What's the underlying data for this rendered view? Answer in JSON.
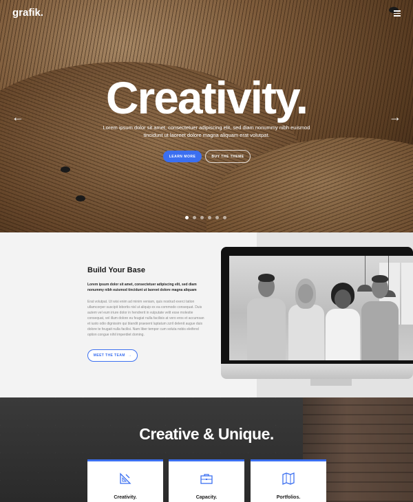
{
  "header": {
    "logo": "grafik.",
    "menu_icon": "hamburger-menu-icon"
  },
  "hero": {
    "title": "Creativity.",
    "subtitle": "Lorem ipsum dolor sit amet, consectetuer adipiscing elit, sed diam nonummy nibh euismod tincidunt ut laoreet dolore magna aliquam erat volutpat.",
    "prev_arrow": "←",
    "next_arrow": "→",
    "primary_button": "LEARN MORE",
    "secondary_button": "BUY THE THEME",
    "slides": 6,
    "active_slide": 1,
    "accent_color": "#3b6ff0"
  },
  "about": {
    "title": "Build Your Base",
    "lead": "Lorem ipsum dolor sit amet, consectetuer adipiscing elit, sed diam nonummy nibh euismod tincidunt ut laoreet dolore magna aliquam",
    "body": "Erat volutpat. Ut wisi enim ad minim veniam, quis nostrud exerci tation ullamcorper suscipit lobortis nisl ut aliquip ex ea commodo consequat. Duis autem vel eum iriure dolor in hendrerit in vulputate velit esse molestie consequat, vel illum dolore eu feugiat nulla facilisis at vero eros et accumsan et iusto odio dignissim qui blandit praesent luptatum zzril delenit augue duis dolore te feugait nulla facilisi. Nam liber tempor cum soluta nobis eleifend option congue nihil imperdiet doming.",
    "button": "MEET THE TEAM",
    "button_arrow": "→"
  },
  "features": {
    "title": "Creative & Unique.",
    "cards": [
      {
        "label": "Creativity.",
        "icon": "ruler-pencil-icon"
      },
      {
        "label": "Capacity.",
        "icon": "briefcase-icon"
      },
      {
        "label": "Portfolios.",
        "icon": "map-icon"
      }
    ]
  }
}
